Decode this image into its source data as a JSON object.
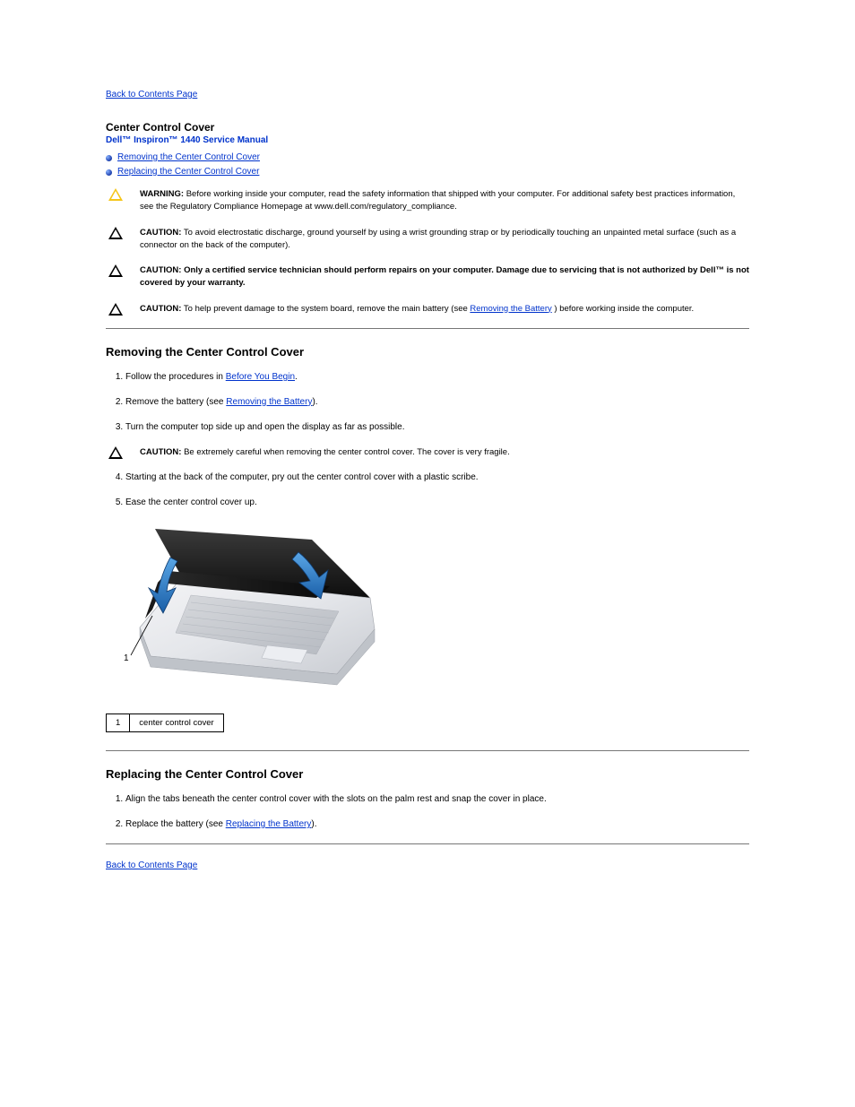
{
  "nav": {
    "back_top": "Back to Contents Page",
    "back_bottom": "Back to Contents Page"
  },
  "header": {
    "title": "Center Control Cover",
    "manual": "Dell™ Inspiron™ 1440 Service Manual"
  },
  "toc": {
    "items": [
      "Removing the Center Control Cover",
      "Replacing the Center Control Cover"
    ]
  },
  "warning": {
    "label": "WARNING:",
    "text": "Before working inside your computer, read the safety information that shipped with your computer. For additional safety best practices information, see the Regulatory Compliance Homepage at www.dell.com/regulatory_compliance."
  },
  "cautions": [
    {
      "label": "CAUTION:",
      "text": "To avoid electrostatic discharge, ground yourself by using a wrist grounding strap or by periodically touching an unpainted metal surface (such as a connector on the back of the computer)."
    },
    {
      "label": "CAUTION:",
      "text": "Only a certified service technician should perform repairs on your computer. Damage due to servicing that is not authorized by Dell™ is not covered by your warranty."
    },
    {
      "label": "CAUTION:",
      "text_before": "To help prevent damage to the system board, remove the main battery (see ",
      "link": "Removing the Battery",
      "text_after": ") before working inside the computer."
    }
  ],
  "section1": {
    "title": "Removing the Center Control Cover",
    "steps": [
      {
        "text_before": "Follow the procedures in ",
        "link": "Before You Begin",
        "text_after": "."
      },
      {
        "text_before": "Remove the battery (see ",
        "link": "Removing the Battery",
        "text_after": ")."
      },
      {
        "text": "Turn the computer top side up and open the display as far as possible."
      }
    ],
    "inner_caution": {
      "label": "CAUTION:",
      "text": "Be extremely careful when removing the center control cover. The cover is very fragile."
    },
    "steps2": [
      {
        "text": "Starting at the back of the computer, pry out the center control cover with a plastic scribe."
      },
      {
        "text": "Ease the center control cover up."
      }
    ],
    "label_table": {
      "num": "1",
      "label": "center control cover"
    }
  },
  "section2": {
    "title": "Replacing the Center Control Cover",
    "steps": [
      {
        "text": "Align the tabs beneath the center control cover with the slots on the palm rest and snap the cover in place."
      },
      {
        "text_before": "Replace the battery (see ",
        "link": "Replacing the Battery",
        "text_after": ")."
      }
    ]
  }
}
